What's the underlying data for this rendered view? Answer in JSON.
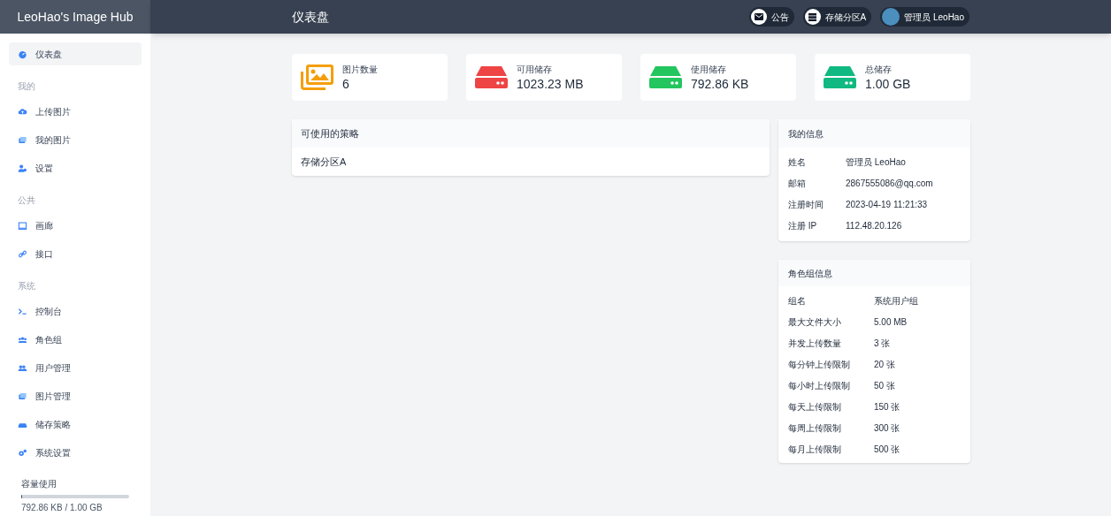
{
  "brand": "LeoHao's Image Hub",
  "header": {
    "title": "仪表盘",
    "chips": [
      {
        "kind": "mail",
        "label": "公告"
      },
      {
        "kind": "storage",
        "label": "存储分区A"
      },
      {
        "kind": "avatar",
        "label": "管理员 LeoHao"
      }
    ]
  },
  "sidebar": {
    "items": [
      {
        "kind": "item",
        "label": "仪表盘",
        "selected": true
      },
      {
        "kind": "section",
        "label": "我的"
      },
      {
        "kind": "item",
        "label": "上传图片",
        "selected": false
      },
      {
        "kind": "item",
        "label": "我的图片",
        "selected": false
      },
      {
        "kind": "item",
        "label": "设置",
        "selected": false
      },
      {
        "kind": "section",
        "label": "公共"
      },
      {
        "kind": "item",
        "label": "画廊",
        "selected": false
      },
      {
        "kind": "item",
        "label": "接口",
        "selected": false
      },
      {
        "kind": "section",
        "label": "系统"
      },
      {
        "kind": "item",
        "label": "控制台",
        "selected": false
      },
      {
        "kind": "item",
        "label": "角色组",
        "selected": false
      },
      {
        "kind": "item",
        "label": "用户管理",
        "selected": false
      },
      {
        "kind": "item",
        "label": "图片管理",
        "selected": false
      },
      {
        "kind": "item",
        "label": "储存策略",
        "selected": false
      },
      {
        "kind": "item",
        "label": "系统设置",
        "selected": false
      }
    ],
    "capacity": {
      "label": "容量使用",
      "level": 0.001,
      "reading": "792.86 KB / 1.00 GB"
    }
  },
  "stats": [
    {
      "kind": "images",
      "color": "#f59e0b",
      "label": "图片数量",
      "value": "6"
    },
    {
      "kind": "drive",
      "color": "#ef4444",
      "label": "可用储存",
      "value": "1023.23 MB"
    },
    {
      "kind": "drive",
      "color": "#22c55e",
      "label": "使用储存",
      "value": "792.86 KB"
    },
    {
      "kind": "drive",
      "color": "#10b981",
      "label": "总储存",
      "value": "1.00 GB"
    }
  ],
  "strategies": {
    "title": "可使用的策略",
    "items": [
      "存储分区A"
    ]
  },
  "my_info": {
    "title": "我的信息",
    "rows": [
      [
        "姓名",
        "管理员 LeoHao"
      ],
      [
        "邮箱",
        "2867555086@qq.com"
      ],
      [
        "注册时间",
        "2023-04-19 11:21:33"
      ],
      [
        "注册 IP",
        "112.48.20.126"
      ]
    ]
  },
  "role_info": {
    "title": "角色组信息",
    "rows": [
      [
        "组名",
        "系统用户组"
      ],
      [
        "最大文件大小",
        "5.00 MB"
      ],
      [
        "并发上传数量",
        "3 张"
      ],
      [
        "每分钟上传限制",
        "20 张"
      ],
      [
        "每小时上传限制",
        "50 张"
      ],
      [
        "每天上传限制",
        "150 张"
      ],
      [
        "每周上传限制",
        "300 张"
      ],
      [
        "每月上传限制",
        "500 张"
      ]
    ]
  }
}
